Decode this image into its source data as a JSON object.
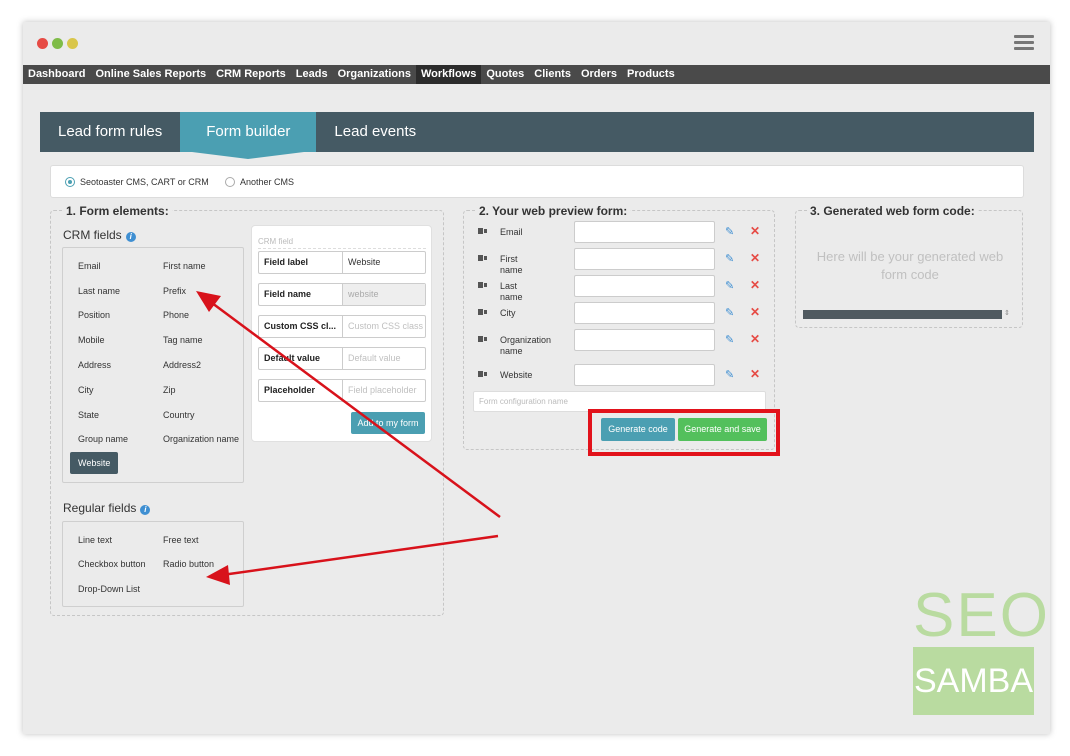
{
  "nav": {
    "items": [
      "Dashboard",
      "Online Sales Reports",
      "CRM Reports",
      "Leads",
      "Organizations",
      "Workflows",
      "Quotes",
      "Clients",
      "Orders",
      "Products"
    ],
    "active": "Workflows"
  },
  "tabs": {
    "items": [
      "Lead form rules",
      "Form builder",
      "Lead events"
    ],
    "active": "Form builder"
  },
  "cms": {
    "option1": "Seotoaster CMS, CART or CRM",
    "option2": "Another CMS",
    "selected": "Seotoaster CMS, CART or CRM"
  },
  "form_elements": {
    "title": "1. Form elements:",
    "crm_title": "CRM fields",
    "crm_fields": [
      "Email",
      "First name",
      "Last name",
      "Prefix",
      "Position",
      "Phone",
      "Mobile",
      "Tag name",
      "Address",
      "Address2",
      "City",
      "Zip",
      "State",
      "Country",
      "Group name",
      "Organization name",
      "Website"
    ],
    "selected_field": "Website",
    "regular_title": "Regular fields",
    "regular_fields": [
      "Line text",
      "Free text",
      "Checkbox button",
      "Radio button",
      "Drop-Down List"
    ]
  },
  "editor": {
    "header": "CRM field",
    "rows": [
      {
        "label": "Field label",
        "value": "Website",
        "placeholder": ""
      },
      {
        "label": "Field name",
        "value": "website",
        "placeholder": ""
      },
      {
        "label": "Custom CSS cl...",
        "value": "",
        "placeholder": "Custom CSS class"
      },
      {
        "label": "Default value",
        "value": "",
        "placeholder": "Default value"
      },
      {
        "label": "Placeholder",
        "value": "",
        "placeholder": "Field placeholder"
      }
    ],
    "add_button": "Add to my form"
  },
  "preview": {
    "title": "2. Your web preview form:",
    "fields": [
      "Email",
      "First name",
      "Last name",
      "City",
      "Organization name",
      "Website"
    ],
    "config_placeholder": "Form configuration name",
    "generate_code": "Generate code",
    "generate_save": "Generate and save"
  },
  "generated": {
    "title": "3. Generated web form code:",
    "placeholder": "Here will be your generated web form code"
  },
  "logo": {
    "top": "SEO",
    "bottom": "SAMBA"
  },
  "colors": {
    "nav_bg": "#4a4a4a",
    "tab_bg": "#455a64",
    "tab_active": "#4b9fb2",
    "green_button": "#53c05c",
    "highlight_red": "#e2121b",
    "logo_green": "#b9dba0"
  }
}
